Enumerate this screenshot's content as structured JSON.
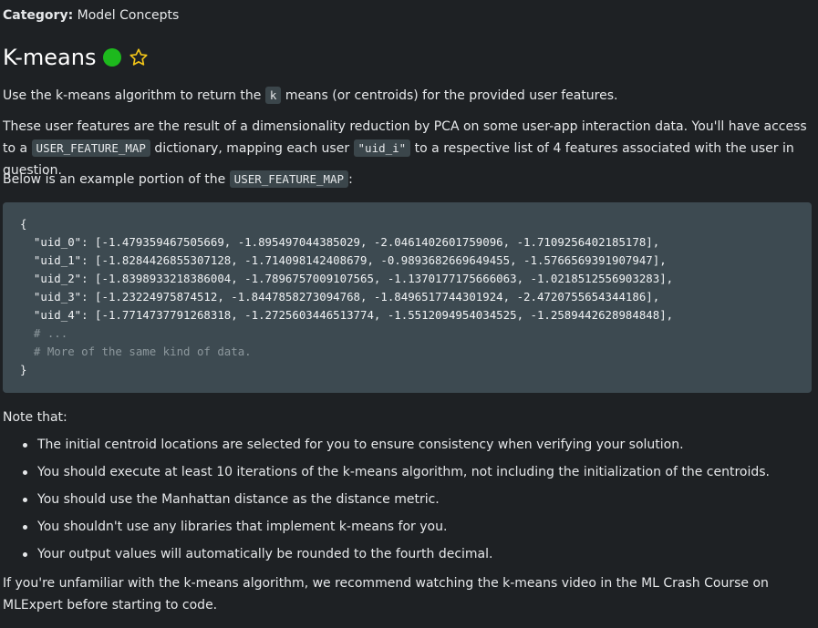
{
  "category": {
    "label": "Category:",
    "value": "Model Concepts"
  },
  "title": {
    "text": "K-means",
    "status_color": "#1db91d",
    "favorite_icon": "star-outline-icon"
  },
  "intro": {
    "p1_before": "Use the k-means algorithm to return the ",
    "p1_code": "k",
    "p1_after": " means (or centroids) for the provided user features.",
    "p2_before": "These user features are the result of a dimensionality reduction by PCA on some user-app interaction data. You'll have access to a ",
    "p2_code1": "USER_FEATURE_MAP",
    "p2_middle": " dictionary, mapping each user ",
    "p2_code2": "\"uid_i\"",
    "p2_after": " to a respective list of 4 features associated with the user in question.",
    "p3_before": "Below is an example portion of the ",
    "p3_code": "USER_FEATURE_MAP",
    "p3_after": ":"
  },
  "code": {
    "lines": [
      "{",
      "  \"uid_0\": [-1.479359467505669, -1.895497044385029, -2.0461402601759096, -1.7109256402185178],",
      "  \"uid_1\": [-1.8284426855307128, -1.714098142408679, -0.9893682669649455, -1.5766569391907947],",
      "  \"uid_2\": [-1.8398933218386004, -1.7896757009107565, -1.1370177175666063, -1.0218512556903283],",
      "  \"uid_3\": [-1.23224975874512, -1.8447858273094768, -1.8496517744301924, -2.4720755654344186],",
      "  \"uid_4\": [-1.7714737791268318, -1.2725603446513774, -1.5512094954034525, -1.2589442628984848],"
    ],
    "comments": [
      "  # ...",
      "  # More of the same kind of data."
    ],
    "closing": "}"
  },
  "note_label": "Note that:",
  "bullets": [
    "The initial centroid locations are selected for you to ensure consistency when verifying your solution.",
    "You should execute at least 10 iterations of the k-means algorithm, not including the initialization of the centroids.",
    "You should use the Manhattan distance as the distance metric.",
    "You shouldn't use any libraries that implement k-means for you.",
    "Your output values will automatically be rounded to the fourth decimal."
  ],
  "closing_paragraph": "If you're unfamiliar with the k-means algorithm, we recommend watching the k-means video in the ML Crash Course on MLExpert before starting to code."
}
